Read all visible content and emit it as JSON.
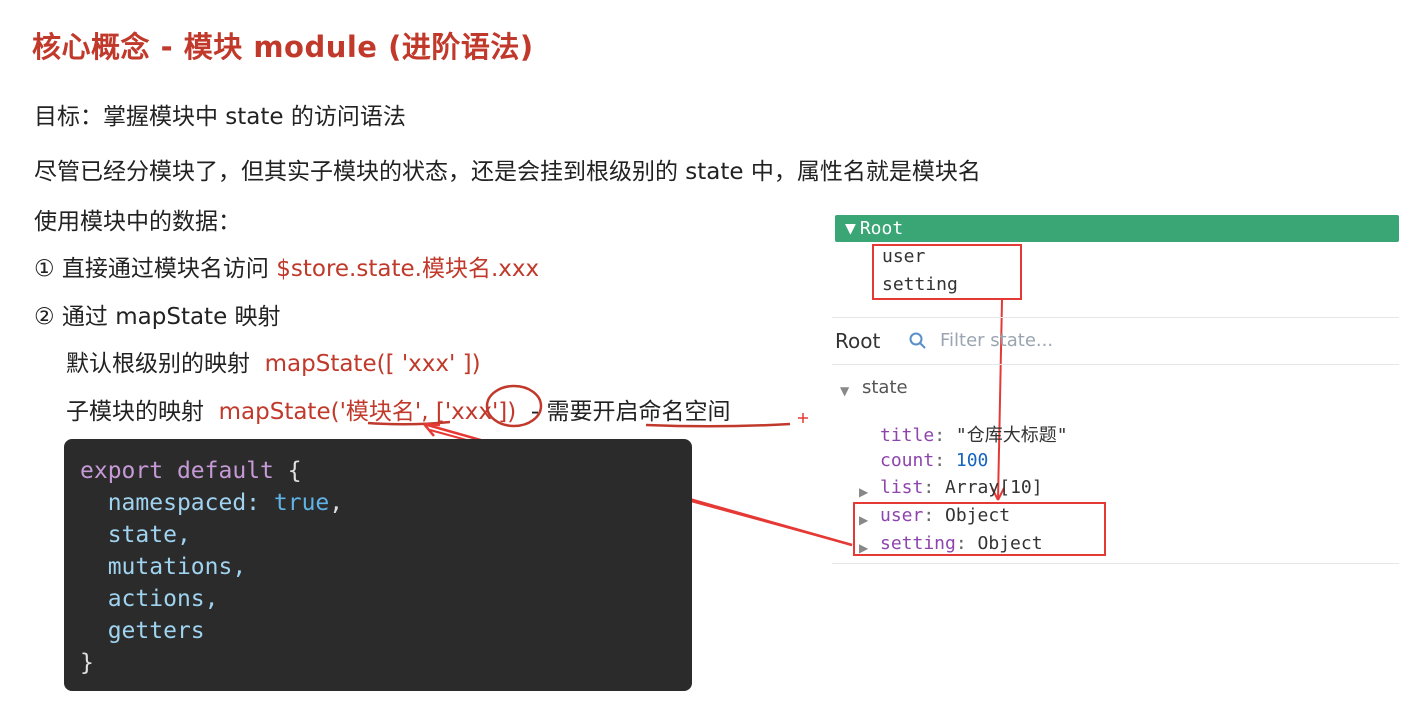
{
  "title": "核心概念 - 模块 module (进阶语法)",
  "goal": "目标：掌握模块中 state 的访问语法",
  "intro": "尽管已经分模块了，但其实子模块的状态，还是会挂到根级别的 state 中，属性名就是模块名",
  "usage_heading": "使用模块中的数据：",
  "item1": {
    "prefix": "① 直接通过模块名访问 ",
    "code": "$store.state.模块名.xxx"
  },
  "item2": {
    "text": "② 通过 mapState 映射"
  },
  "sub1": {
    "label": "默认根级别的映射",
    "code": "mapState([ 'xxx' ])"
  },
  "sub2": {
    "label": "子模块的映射",
    "code": "mapState('模块名', ['xxx'])",
    "note": "- 需要开启命名空间"
  },
  "code_block": {
    "export": "export",
    "default": "default",
    "brace_open": "{",
    "namespaced_key": "namespaced:",
    "namespaced_val": "true",
    "comma": ",",
    "state": "state,",
    "mutations": "mutations,",
    "actions": "actions,",
    "getters": "getters",
    "brace_close": "}"
  },
  "devtools": {
    "root_label": "Root",
    "tree_children": [
      "user",
      "setting"
    ],
    "root_title": "Root",
    "filter_placeholder": "Filter state...",
    "section": "state",
    "state_items": [
      {
        "key": "title",
        "value": "\"仓库大标题\""
      },
      {
        "key": "count",
        "value": "100"
      },
      {
        "key": "list",
        "value": "Array[10]"
      },
      {
        "key": "user",
        "value": "Object"
      },
      {
        "key": "setting",
        "value": "Object"
      }
    ]
  },
  "colors": {
    "accent_red": "#c0392b",
    "highlight_red": "#e53935",
    "devtools_green": "#3aa676",
    "code_bg": "#2b2b2b"
  }
}
